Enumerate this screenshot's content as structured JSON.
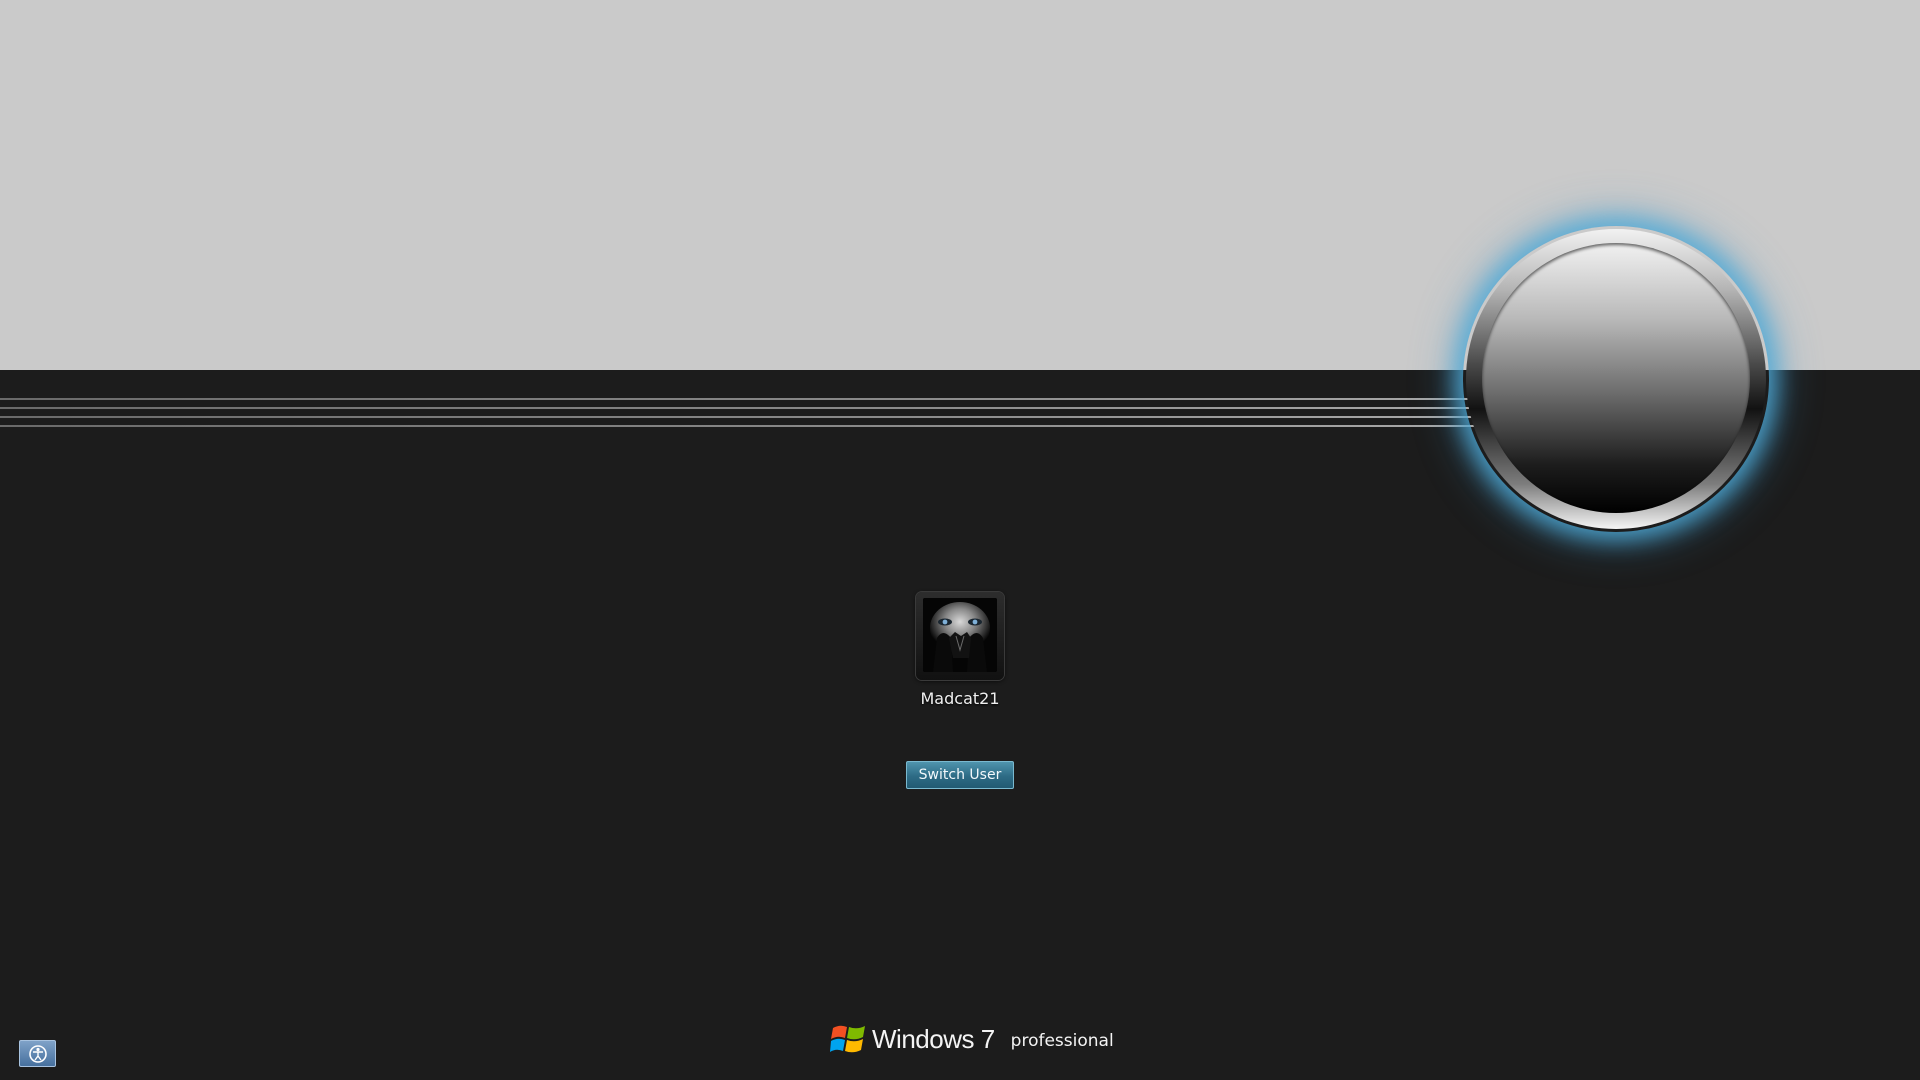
{
  "user": {
    "name": "Madcat21"
  },
  "actions": {
    "switch_user_label": "Switch User"
  },
  "branding": {
    "product": "Windows 7",
    "edition": "professional",
    "logo_icon": "windows-flag-icon"
  },
  "accessibility": {
    "icon": "ease-of-access-icon"
  },
  "colors": {
    "background_dark": "#1c1c1c",
    "background_light": "#cacaca",
    "orb_glow": "#50aad7",
    "button_accent": "#2d6b85"
  }
}
